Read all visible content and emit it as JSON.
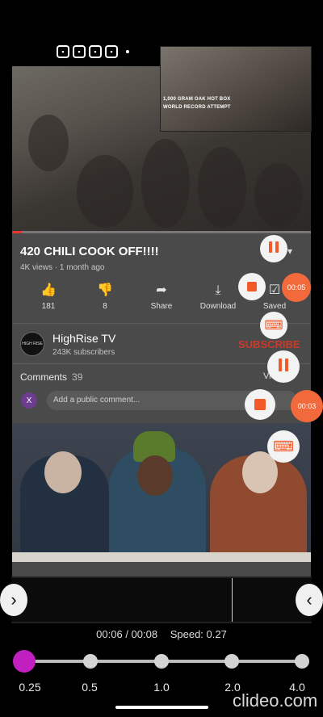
{
  "status_bar": {
    "icons": [
      "notification-icon",
      "notification-icon",
      "notification-icon",
      "notification-icon"
    ],
    "dot": "•"
  },
  "pip": {
    "caption_line1": "1,000 GRAM OAK HOT BOX",
    "caption_line2": "WORLD RECORD ATTEMPT"
  },
  "video": {
    "title": "420 CHILI COOK OFF!!!!",
    "meta": "4K views · 1 month ago",
    "expand_icon": "chevron-down-icon"
  },
  "actions": [
    {
      "label": "181",
      "icon": "thumbs-up-icon",
      "glyph": "👍"
    },
    {
      "label": "8",
      "icon": "thumbs-down-icon",
      "glyph": "👎"
    },
    {
      "label": "Share",
      "icon": "share-icon",
      "glyph": "➦"
    },
    {
      "label": "Download",
      "icon": "download-icon",
      "glyph": "⤓"
    },
    {
      "label": "Saved",
      "icon": "saved-icon",
      "glyph": "☑"
    }
  ],
  "channel": {
    "name": "HighRise TV",
    "subscribers": "243K subscribers",
    "subscribe_label": "SUBSCRIBE",
    "logo_text": "HIGH RISE"
  },
  "comments": {
    "label": "Comments",
    "count": "39",
    "view_all": "View all",
    "avatar_letter": "X",
    "placeholder": "Add a public comment..."
  },
  "recorder": {
    "timer1": "00:05",
    "timer2": "00:03"
  },
  "editor": {
    "time_current": "00:06 / 00:08",
    "speed_label": "Speed: 0.27",
    "speed_options": [
      "0.25",
      "0.5",
      "1.0",
      "2.0",
      "4.0"
    ],
    "selected_speed": "0.25"
  },
  "watermark": "clideo.com",
  "colors": {
    "subscribe": "#cc3a2c",
    "recorder_accent": "#f25a2a",
    "speed_active": "#c21fc0"
  }
}
